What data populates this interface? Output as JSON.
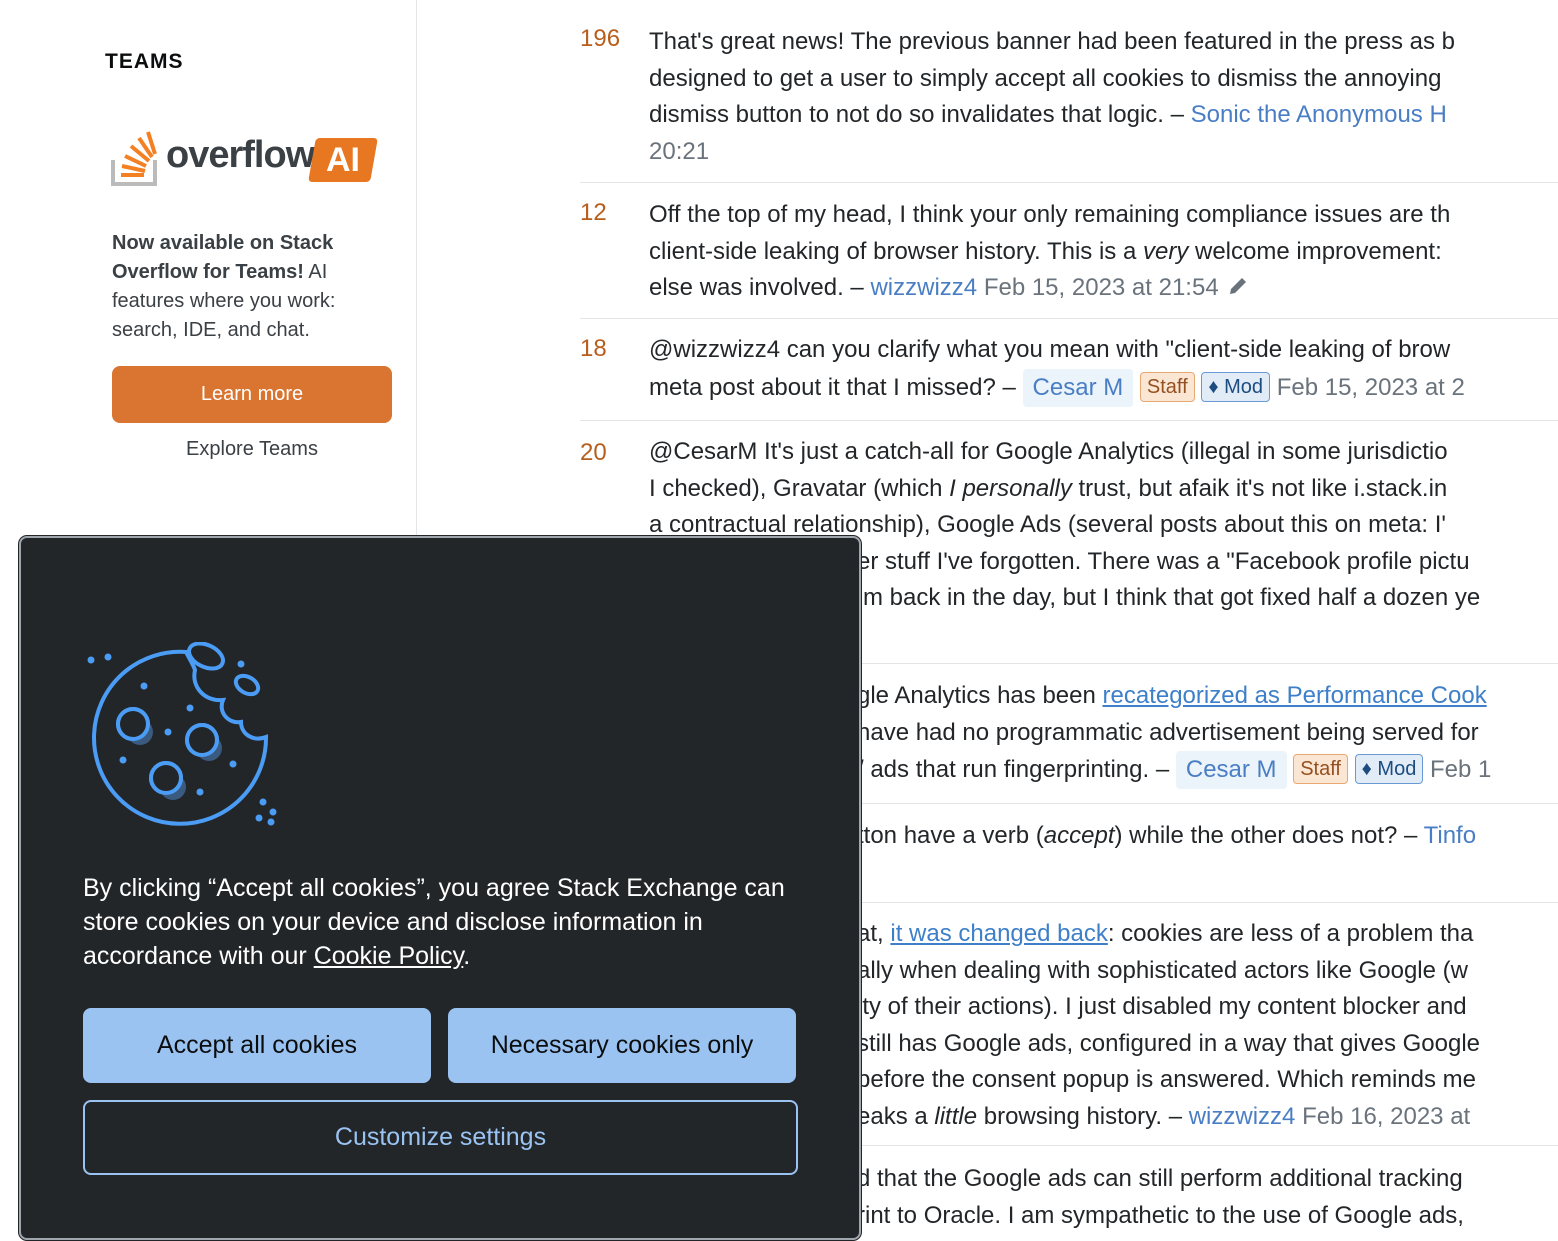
{
  "sidebar": {
    "heading": "TEAMS",
    "logo_word": "overflow",
    "logo_badge": "AI",
    "promo_bold": "Now available on Stack Overflow for Teams!",
    "promo_rest": " AI features where you work: search, IDE, and chat.",
    "learn_more": "Learn more",
    "explore": "Explore Teams",
    "accent_color": "#d97530"
  },
  "comments": [
    {
      "score": "196",
      "line1": "That's great news! The previous banner had been featured in the press as b",
      "line2": "designed to get a user to simply accept all cookies to dismiss the annoying",
      "line3_pre": "dismiss button to not do so invalidates that logic. – ",
      "user": "Sonic the Anonymous H",
      "line4": "20:21"
    },
    {
      "score": "12",
      "line1": "Off the top of my head, I think your only remaining compliance issues are th",
      "line2_pre": "client-side leaking of browser history. This is a ",
      "line2_em": "very",
      "line2_post": " welcome improvement:",
      "line3_pre": "else was involved. – ",
      "user": "wizzwizz4",
      "date": "Feb 15, 2023 at 21:54"
    },
    {
      "score": "18",
      "line1": "@wizzwizz4 can you clarify what you mean with \"client-side leaking of brow",
      "line2_pre": "meta post about it that I missed? – ",
      "user": "Cesar M",
      "staff": "Staff",
      "mod": "♦ Mod",
      "date": "Feb 15, 2023 at 2"
    },
    {
      "score": "20",
      "line1": "@CesarM It's just a catch-all for Google Analytics (illegal in some jurisdictio",
      "line2_pre": "I checked), Gravatar (which ",
      "line2_em": "I personally",
      "line2_post": " trust, but afaik it's not like i.stack.in",
      "line3": "a contractual relationship), Google Ads (several posts about this on meta: I'",
      "line4": "er stuff I've forgotten. There was a \"Facebook profile pictu",
      "line5": "m back in the day, but I think that got fixed half a dozen ye"
    },
    {
      "line1_pre": "gle Analytics has been ",
      "link": "recategorized as Performance Cook",
      "line2": "have had no programmatic advertisement being served for",
      "line3_pre": "/ ads that run fingerprinting. – ",
      "user": "Cesar M",
      "staff": "Staff",
      "mod": "♦ Mod",
      "date": "Feb 1"
    },
    {
      "line1_pre": "tton have a verb (",
      "line1_em": "accept",
      "line1_post": ") while the other does not? – ",
      "user": "Tinfo"
    },
    {
      "line1_pre": "at, ",
      "link": "it was changed back",
      "line1_post": ": cookies are less of a problem tha",
      "line2": "ally when dealing with sophisticated actors like Google (w",
      "line3": "ity of their actions). I just disabled my content blocker and",
      "line4": "still has Google ads, configured in a way that gives Google",
      "line5": "before the consent popup is answered. Which reminds me",
      "line6_pre": "eaks a ",
      "line6_em": "little",
      "line6_post": " browsing history. – ",
      "user": "wizzwizz4",
      "date": "Feb 16, 2023 at"
    },
    {
      "line1": "d that the Google ads can still perform additional tracking",
      "line2": "rint to Oracle. I am sympathetic to the use of Google ads,"
    }
  ],
  "cookie_dialog": {
    "text_pre": "By clicking “Accept all cookies”, you agree Stack Exchange can store cookies on your device and disclose information in accordance with our ",
    "policy_link": "Cookie Policy",
    "text_post": ".",
    "accept_all": "Accept all cookies",
    "necessary_only": "Necessary cookies only",
    "customize": "Customize settings",
    "icon": "cookie-icon",
    "button_color": "#9ac3f2",
    "background_color": "#232629"
  }
}
